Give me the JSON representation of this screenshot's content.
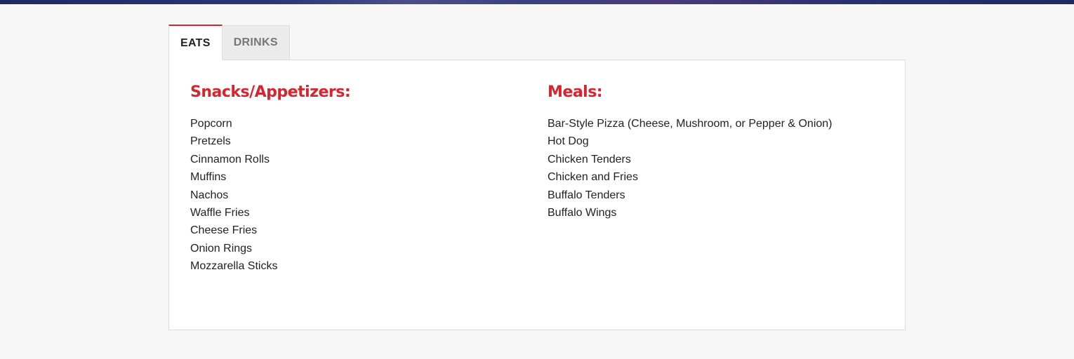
{
  "tabs": [
    {
      "label": "EATS",
      "active": true
    },
    {
      "label": "DRINKS",
      "active": false
    }
  ],
  "snacks": {
    "heading": "Snacks/Appetizers:",
    "items": [
      "Popcorn",
      "Pretzels",
      "Cinnamon Rolls",
      "Muffins",
      "Nachos",
      "Waffle Fries",
      "Cheese Fries",
      "Onion Rings",
      "Mozzarella Sticks"
    ]
  },
  "meals": {
    "heading": "Meals:",
    "items": [
      "Bar-Style Pizza (Cheese, Mushroom, or Pepper & Onion)",
      "Hot Dog",
      "Chicken Tenders",
      "Chicken and Fries",
      "Buffalo Tenders",
      "Buffalo Wings"
    ]
  },
  "colors": {
    "accent": "#d6252f",
    "banner": "#1f2a63",
    "page_background": "#f7f7f7"
  }
}
